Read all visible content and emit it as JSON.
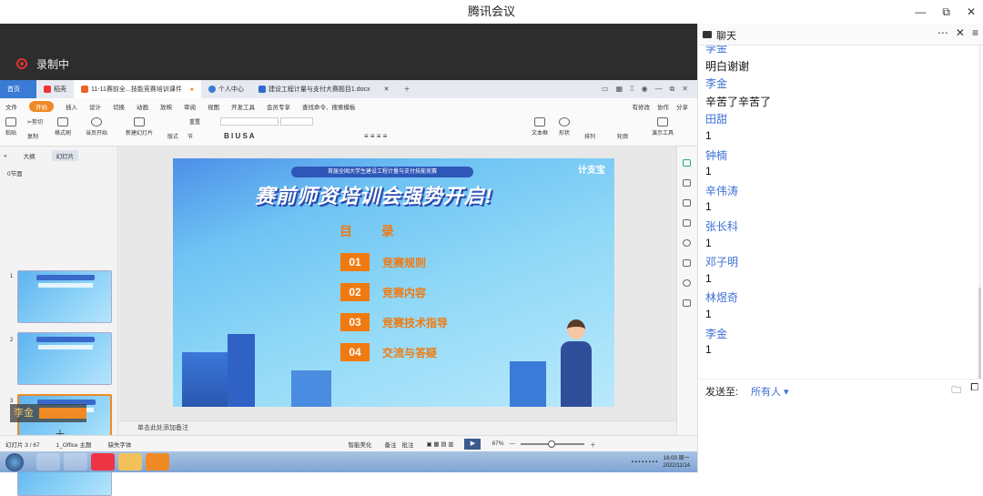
{
  "window": {
    "title": "腾讯会议",
    "min": "—",
    "restore": "⧉",
    "close": "✕"
  },
  "recording": {
    "label": "录制中"
  },
  "wps": {
    "tabs": [
      {
        "label": "首页"
      },
      {
        "label": "稻壳"
      },
      {
        "label": "11-11赛前全...技能竞赛培训课件"
      },
      {
        "label": "个人中心"
      },
      {
        "label": "建设工程计量与支付大赛题目1.docx"
      }
    ],
    "menu": [
      "文件",
      "开始",
      "插入",
      "设计",
      "切换",
      "动画",
      "放映",
      "审阅",
      "视图",
      "开发工具",
      "会员专享",
      "查找命令、搜索模板"
    ],
    "menu_right": [
      "有修改",
      "协作",
      "分享"
    ],
    "ribbon": [
      "粘贴",
      "剪切",
      "复制",
      "格式刷",
      "当页开始",
      "新建幻灯片",
      "版式",
      "节",
      "重置",
      "文本框",
      "形状",
      "排列",
      "轮廓",
      "演示工具"
    ],
    "thumb_tabs": [
      "大纲",
      "幻灯片"
    ],
    "section": "0节面",
    "slide_numbers": [
      "1",
      "2",
      "3",
      "4"
    ],
    "presenter_tag": "李金",
    "notes": "单击此处添加备注",
    "status": {
      "slide": "幻灯片 3 / 67",
      "theme": "1_Office 主题",
      "font": "缺失字体",
      "smart": "智能美化",
      "notes_btn": "备注",
      "comment": "批注",
      "zoom": "67%"
    },
    "clock": {
      "time": "16:03 周一",
      "date": "2022/11/14"
    }
  },
  "slide": {
    "banner": "首届全国大学生建设工程计量与支付技能竞赛",
    "title": "赛前师资培训会强势开启!",
    "logo": "计支宝",
    "toc_heading": "目 录",
    "items": [
      {
        "num": "01",
        "text": "竞赛规则"
      },
      {
        "num": "02",
        "text": "竞赛内容"
      },
      {
        "num": "03",
        "text": "竞赛技术指导"
      },
      {
        "num": "04",
        "text": "交流与答疑"
      }
    ]
  },
  "chat": {
    "title": "聊天",
    "messages": [
      {
        "type": "name",
        "text": "李金"
      },
      {
        "type": "text",
        "text": "明白谢谢"
      },
      {
        "type": "name",
        "text": "李金"
      },
      {
        "type": "text",
        "text": "辛苦了辛苦了"
      },
      {
        "type": "name",
        "text": "田甜"
      },
      {
        "type": "text",
        "text": "1"
      },
      {
        "type": "name",
        "text": "钟楠"
      },
      {
        "type": "text",
        "text": "1"
      },
      {
        "type": "name",
        "text": "辛伟涛"
      },
      {
        "type": "text",
        "text": "1"
      },
      {
        "type": "name",
        "text": "张长科"
      },
      {
        "type": "text",
        "text": "1"
      },
      {
        "type": "name",
        "text": "邓子明"
      },
      {
        "type": "text",
        "text": "1"
      },
      {
        "type": "name",
        "text": "林煜奇"
      },
      {
        "type": "text",
        "text": "1"
      },
      {
        "type": "name",
        "text": "李金"
      },
      {
        "type": "text",
        "text": "1"
      }
    ],
    "send_to_label": "发送至:",
    "recipient": "所有人 ▾"
  },
  "colors": {
    "accent_orange": "#f07a10",
    "chat_name": "#3d6fd6",
    "wps_blue": "#3a7bd5"
  }
}
